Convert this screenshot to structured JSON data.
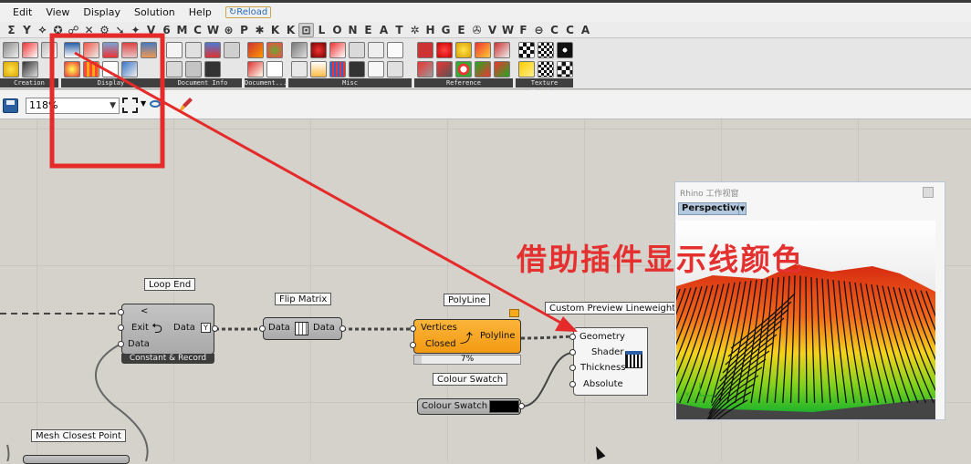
{
  "menu": {
    "items": [
      "Edit",
      "View",
      "Display",
      "Solution",
      "Help"
    ],
    "reload_label": "Reload"
  },
  "component_tabs": [
    "Σ",
    "Y",
    "⟡",
    "✪",
    "☍",
    "✕",
    "⚙",
    "➘",
    "✦",
    "V",
    "6",
    "M",
    "C",
    "W",
    "⊛",
    "P",
    "✱",
    "K",
    "K",
    "⊡",
    "L",
    "O",
    "N",
    "E",
    "A",
    "T",
    "✲",
    "H",
    "G",
    "E",
    "✇",
    "V",
    "W",
    "F",
    "⊖",
    "C",
    "C",
    "A"
  ],
  "ribbon": {
    "panels": [
      {
        "label": "Creation"
      },
      {
        "label": "Display"
      },
      {
        "label": "Document Info"
      },
      {
        "label": "Document..."
      },
      {
        "label": "Misc"
      },
      {
        "label": "Reference"
      },
      {
        "label": "Texture Mapping"
      }
    ]
  },
  "toolbar": {
    "zoom_value": "118%"
  },
  "nodes": {
    "loop_end": {
      "tag": "Loop End",
      "input_lt": "<",
      "input_exit": "Exit",
      "input_data": "Data",
      "output_data": "Data",
      "footer": "Constant & Record"
    },
    "flip_matrix": {
      "tag": "Flip Matrix",
      "input": "Data",
      "output": "Data"
    },
    "polyline": {
      "tag": "PolyLine",
      "input_vertices": "Vertices",
      "input_closed": "Closed",
      "output": "Polyline",
      "progress_label": "7%",
      "progress_fraction": 0.07
    },
    "custom_preview": {
      "tag": "Custom Preview Lineweights",
      "inputs": [
        "Geometry",
        "Shader",
        "Thickness",
        "Absolute"
      ]
    },
    "colour_swatch": {
      "tag": "Colour Swatch",
      "label": "Colour Swatch",
      "color": "#000000"
    },
    "mesh_closest_point": {
      "tag": "Mesh Closest Point"
    }
  },
  "viewport": {
    "window_title": "Rhino 工作视窗",
    "view_name": "Perspective"
  },
  "annotation": {
    "caption": "借助插件显示线颜色",
    "color": "#e53030"
  }
}
